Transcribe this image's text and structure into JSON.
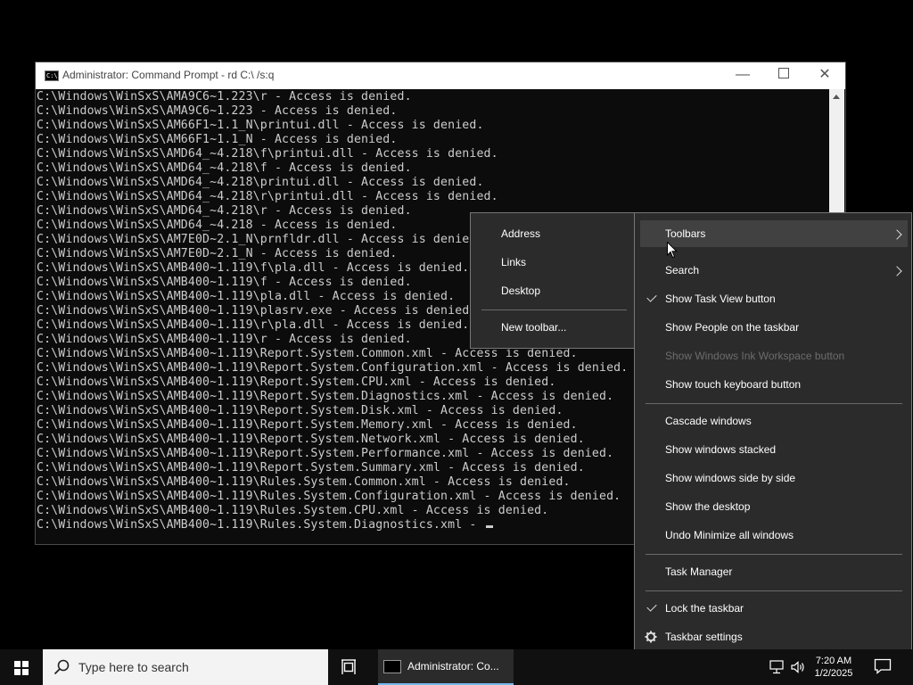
{
  "window": {
    "title": "Administrator: Command Prompt - rd  C:\\ /s:q",
    "controls": {
      "minimize": "—",
      "close": "✕"
    }
  },
  "console": {
    "lines": [
      "C:\\Windows\\WinSxS\\AMA9C6~1.223\\r - Access is denied.",
      "C:\\Windows\\WinSxS\\AMA9C6~1.223 - Access is denied.",
      "C:\\Windows\\WinSxS\\AM66F1~1.1_N\\printui.dll - Access is denied.",
      "C:\\Windows\\WinSxS\\AM66F1~1.1_N - Access is denied.",
      "C:\\Windows\\WinSxS\\AMD64_~4.218\\f\\printui.dll - Access is denied.",
      "C:\\Windows\\WinSxS\\AMD64_~4.218\\f - Access is denied.",
      "C:\\Windows\\WinSxS\\AMD64_~4.218\\printui.dll - Access is denied.",
      "C:\\Windows\\WinSxS\\AMD64_~4.218\\r\\printui.dll - Access is denied.",
      "C:\\Windows\\WinSxS\\AMD64_~4.218\\r - Access is denied.",
      "C:\\Windows\\WinSxS\\AMD64_~4.218 - Access is denied.",
      "C:\\Windows\\WinSxS\\AM7E0D~2.1_N\\prnfldr.dll - Access is denied.",
      "C:\\Windows\\WinSxS\\AM7E0D~2.1_N - Access is denied.",
      "C:\\Windows\\WinSxS\\AMB400~1.119\\f\\pla.dll - Access is denied.",
      "C:\\Windows\\WinSxS\\AMB400~1.119\\f - Access is denied.",
      "C:\\Windows\\WinSxS\\AMB400~1.119\\pla.dll - Access is denied.",
      "C:\\Windows\\WinSxS\\AMB400~1.119\\plasrv.exe - Access is denied.",
      "C:\\Windows\\WinSxS\\AMB400~1.119\\r\\pla.dll - Access is denied.",
      "C:\\Windows\\WinSxS\\AMB400~1.119\\r - Access is denied.",
      "C:\\Windows\\WinSxS\\AMB400~1.119\\Report.System.Common.xml - Access is denied.",
      "C:\\Windows\\WinSxS\\AMB400~1.119\\Report.System.Configuration.xml - Access is denied.",
      "C:\\Windows\\WinSxS\\AMB400~1.119\\Report.System.CPU.xml - Access is denied.",
      "C:\\Windows\\WinSxS\\AMB400~1.119\\Report.System.Diagnostics.xml - Access is denied.",
      "C:\\Windows\\WinSxS\\AMB400~1.119\\Report.System.Disk.xml - Access is denied.",
      "C:\\Windows\\WinSxS\\AMB400~1.119\\Report.System.Memory.xml - Access is denied.",
      "C:\\Windows\\WinSxS\\AMB400~1.119\\Report.System.Network.xml - Access is denied.",
      "C:\\Windows\\WinSxS\\AMB400~1.119\\Report.System.Performance.xml - Access is denied.",
      "C:\\Windows\\WinSxS\\AMB400~1.119\\Report.System.Summary.xml - Access is denied.",
      "C:\\Windows\\WinSxS\\AMB400~1.119\\Rules.System.Common.xml - Access is denied.",
      "C:\\Windows\\WinSxS\\AMB400~1.119\\Rules.System.Configuration.xml - Access is denied.",
      "C:\\Windows\\WinSxS\\AMB400~1.119\\Rules.System.CPU.xml - Access is denied.",
      "C:\\Windows\\WinSxS\\AMB400~1.119\\Rules.System.Diagnostics.xml - "
    ]
  },
  "toolbars_submenu": {
    "address": "Address",
    "links": "Links",
    "desktop": "Desktop",
    "new_toolbar": "New toolbar..."
  },
  "taskbar_menu": {
    "toolbars": "Toolbars",
    "search": "Search",
    "show_task_view": "Show Task View button",
    "show_people": "Show People on the taskbar",
    "show_ink": "Show Windows Ink Workspace button",
    "show_touch_keyboard": "Show touch keyboard button",
    "cascade": "Cascade windows",
    "stacked": "Show windows stacked",
    "side_by_side": "Show windows side by side",
    "show_desktop": "Show the desktop",
    "undo_minimize": "Undo Minimize all windows",
    "task_manager": "Task Manager",
    "lock_taskbar": "Lock the taskbar",
    "taskbar_settings": "Taskbar settings"
  },
  "taskbar": {
    "search_placeholder": "Type here to search",
    "cmd_task_label": "Administrator: Co...",
    "time": "7:20 AM",
    "date": "1/2/2025"
  }
}
